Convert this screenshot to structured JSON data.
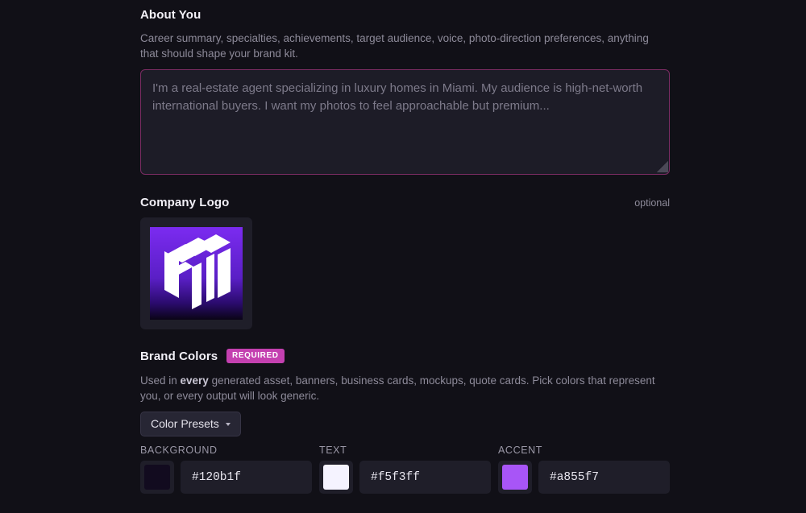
{
  "about": {
    "title": "About You",
    "description": "Career summary, specialties, achievements, target audience, voice, photo-direction preferences, anything that should shape your brand kit.",
    "placeholder": "I'm a real-estate agent specializing in luxury homes in Miami. My audience is high-net-worth international buyers. I want my photos to feel approachable but premium...",
    "value": ""
  },
  "logo": {
    "title": "Company Logo",
    "optional_label": "optional",
    "icon": "isometric-stacked-blocks-logo"
  },
  "brand_colors": {
    "title": "Brand Colors",
    "badge": "REQUIRED",
    "description_pre": "Used in ",
    "description_bold": "every",
    "description_post": " generated asset, banners, business cards, mockups, quote cards. Pick colors that represent you, or every output will look generic.",
    "presets_label": "Color Presets",
    "colors": [
      {
        "label": "BACKGROUND",
        "value": "#120b1f"
      },
      {
        "label": "TEXT",
        "value": "#f5f3ff"
      },
      {
        "label": "ACCENT",
        "value": "#a855f7"
      }
    ]
  },
  "theme": {
    "page_bg": "#111017",
    "badge_bg": "#c440b0",
    "textarea_border": "#7a2c62"
  }
}
